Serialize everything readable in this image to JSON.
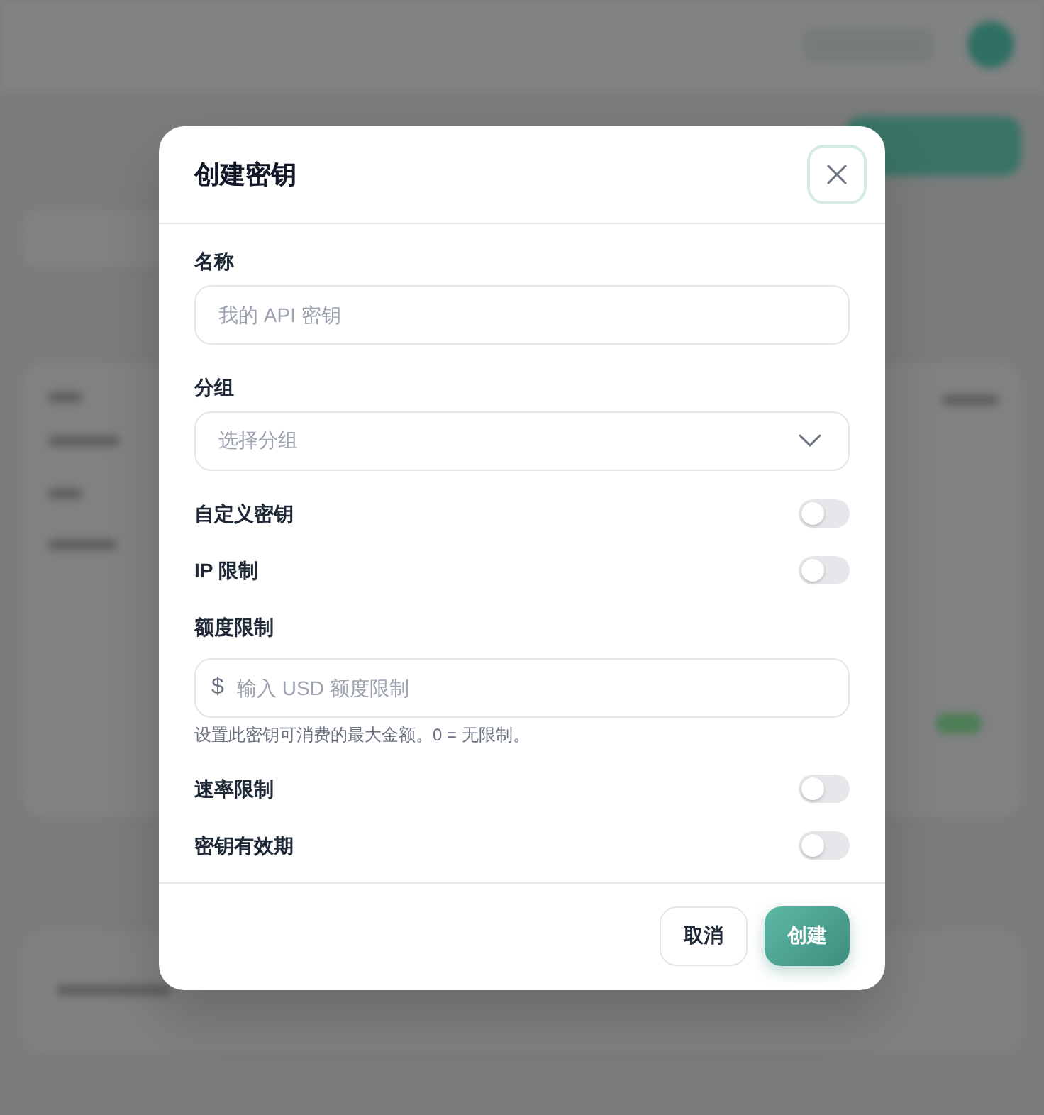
{
  "dialog": {
    "title": "创建密钥"
  },
  "fields": [
    {
      "kind": "text",
      "label": "名称",
      "placeholder": "我的 API 密钥"
    },
    {
      "kind": "select",
      "label": "分组",
      "placeholder": "选择分组"
    },
    {
      "kind": "toggle",
      "label": "自定义密钥",
      "on": false
    },
    {
      "kind": "toggle",
      "label": "IP 限制",
      "on": false
    },
    {
      "kind": "currency",
      "label": "额度限制",
      "prefix": "$",
      "placeholder": "输入 USD 额度限制",
      "hint": "设置此密钥可消费的最大金额。0 = 无限制。"
    },
    {
      "kind": "toggle",
      "label": "速率限制",
      "on": false
    },
    {
      "kind": "toggle",
      "label": "密钥有效期",
      "on": false
    }
  ],
  "buttons": [
    {
      "kind": "secondary",
      "label": "取消"
    },
    {
      "kind": "primary",
      "label": "创建"
    }
  ]
}
